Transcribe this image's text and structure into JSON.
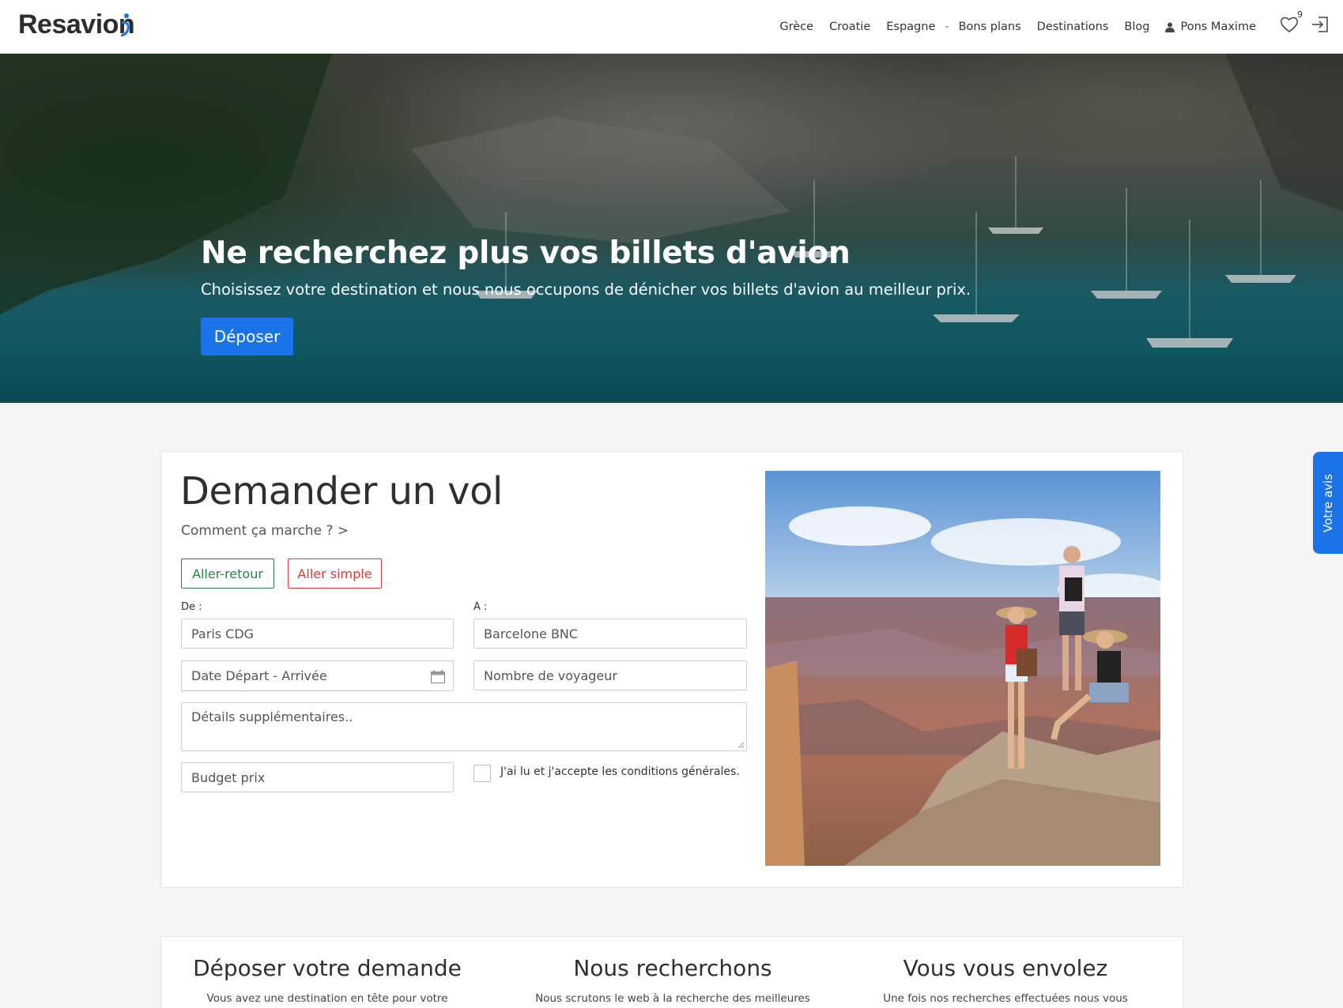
{
  "header": {
    "logo": "Resavion",
    "nav": [
      "Grèce",
      "Croatie",
      "Espagne",
      "Bons plans",
      "Destinations",
      "Blog"
    ],
    "nav_separator": "-",
    "user_name": "Pons Maxime",
    "favorites_count": "9"
  },
  "hero": {
    "title": "Ne recherchez plus vos billets d'avion",
    "subtitle": "Choisissez votre destination et nous nous occupons de dénicher vos billets d'avion au meilleur prix.",
    "button": "Déposer"
  },
  "form": {
    "title": "Demander un vol",
    "how_link": "Comment ça marche ? >",
    "trip_roundtrip": "Aller-retour",
    "trip_oneway": "Aller simple",
    "label_from": "De :",
    "label_to": "A :",
    "from_placeholder": "Paris CDG",
    "to_placeholder": "Barcelone BNC",
    "date_placeholder": "Date Départ - Arrivée",
    "travellers_placeholder": "Nombre de voyageur",
    "details_placeholder": "Détails supplémentaires..",
    "budget_placeholder": "Budget prix",
    "terms_label": "J'ai lu et j'accepte les conditions générales."
  },
  "steps": [
    {
      "title": "Déposer votre demande",
      "text": "Vous avez une destination en tête pour votre"
    },
    {
      "title": "Nous recherchons",
      "text": "Nous scrutons le web à la recherche des meilleures"
    },
    {
      "title": "Vous vous envolez",
      "text": "Une fois nos recherches effectuées nous vous"
    }
  ],
  "side_tab": "Votre avis",
  "colors": {
    "accent": "#1a73e8",
    "roundtrip": "#2f7d4f",
    "oneway": "#d33b3b"
  }
}
